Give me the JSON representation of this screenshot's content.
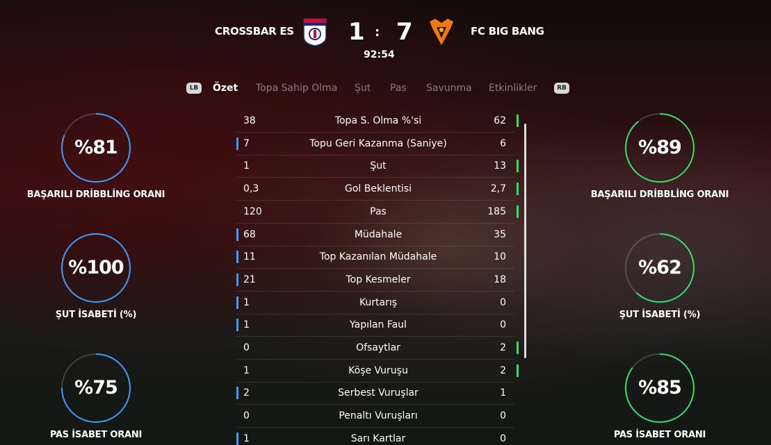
{
  "header": {
    "home_team": "CROSSBAR ES",
    "away_team": "FC BIG BANG",
    "home_score": "1",
    "away_score": "7",
    "separator": ":",
    "clock": "92:54",
    "home_color": "#3d9bff",
    "away_color": "#2fe06c"
  },
  "tabs": {
    "lb": "LB",
    "rb": "RB",
    "items": [
      "Özet",
      "Topa Sahip Olma",
      "Şut",
      "Pas",
      "Savunma",
      "Etkinlikler"
    ],
    "active": "Özet"
  },
  "home_rings": [
    {
      "value": "%81",
      "label": "BAŞARILI DRİBBLİNG ORANI",
      "fraction": 0.81
    },
    {
      "value": "%100",
      "label": "ŞUT İSABETİ (%)",
      "fraction": 1.0
    },
    {
      "value": "%75",
      "label": "PAS İSABET ORANI",
      "fraction": 0.75
    }
  ],
  "away_rings": [
    {
      "value": "%89",
      "label": "BAŞARILI DRİBBLİNG ORANI",
      "fraction": 0.89
    },
    {
      "value": "%62",
      "label": "ŞUT İSABETİ (%)",
      "fraction": 0.62
    },
    {
      "value": "%85",
      "label": "PAS İSABET ORANI",
      "fraction": 0.85
    }
  ],
  "stats": [
    {
      "home": "38",
      "label": "Topa S. Olma %'si",
      "away": "62",
      "lead": "away"
    },
    {
      "home": "7",
      "label": "Topu Geri Kazanma (Saniye)",
      "away": "6",
      "lead": "home"
    },
    {
      "home": "1",
      "label": "Şut",
      "away": "13",
      "lead": "away"
    },
    {
      "home": "0,3",
      "label": "Gol Beklentisi",
      "away": "2,7",
      "lead": "away"
    },
    {
      "home": "120",
      "label": "Pas",
      "away": "185",
      "lead": "away"
    },
    {
      "home": "68",
      "label": "Müdahale",
      "away": "35",
      "lead": "home"
    },
    {
      "home": "11",
      "label": "Top Kazanılan Müdahale",
      "away": "10",
      "lead": "home"
    },
    {
      "home": "21",
      "label": "Top Kesmeler",
      "away": "18",
      "lead": "home"
    },
    {
      "home": "1",
      "label": "Kurtarış",
      "away": "0",
      "lead": "home"
    },
    {
      "home": "1",
      "label": "Yapılan Faul",
      "away": "0",
      "lead": "home"
    },
    {
      "home": "0",
      "label": "Ofsaytlar",
      "away": "2",
      "lead": "away"
    },
    {
      "home": "1",
      "label": "Köşe Vuruşu",
      "away": "2",
      "lead": "away"
    },
    {
      "home": "2",
      "label": "Serbest Vuruşlar",
      "away": "1",
      "lead": "home"
    },
    {
      "home": "0",
      "label": "Penaltı Vuruşları",
      "away": "0",
      "lead": "none"
    },
    {
      "home": "1",
      "label": "Sarı Kartlar",
      "away": "0",
      "lead": "home"
    }
  ]
}
